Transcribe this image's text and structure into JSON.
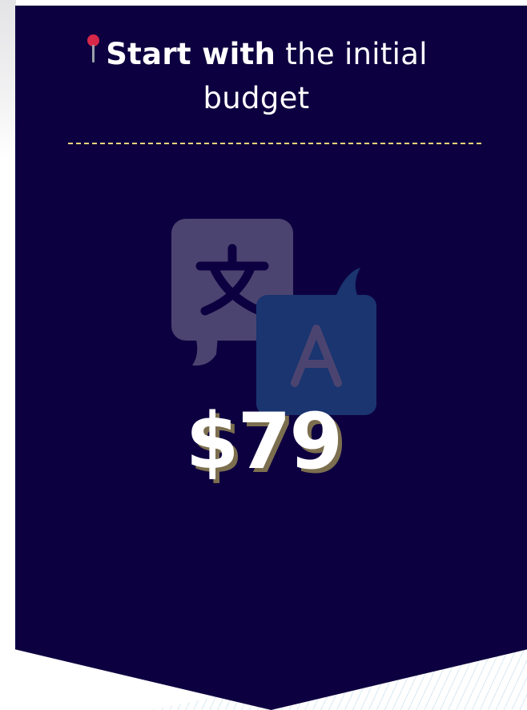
{
  "card": {
    "heading_bold": "Start with",
    "heading_light": "the initial budget",
    "price": "$79",
    "icon": "translate-icon",
    "pin_icon": "round-pushpin-icon"
  },
  "colors": {
    "banner": "#0d0040",
    "divider": "#f2d37a",
    "price_shadow": "#7c6f4f",
    "icon_back": "#4c4470",
    "icon_front": "#1a3570"
  }
}
